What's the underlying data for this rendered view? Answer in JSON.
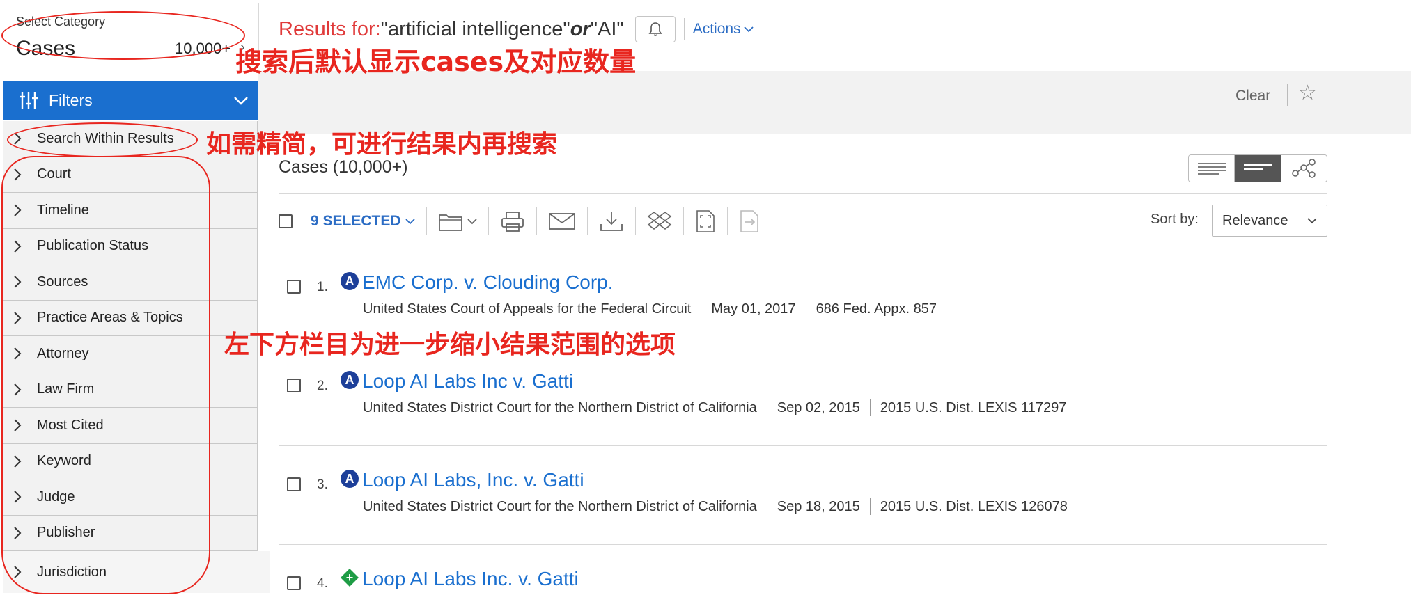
{
  "category": {
    "label": "Select Category",
    "value": "Cases",
    "count": "10,000+"
  },
  "results_header": {
    "prefix": "Results for:",
    "term1": "\"artificial intelligence\"",
    "operator": "or",
    "term2": "\"AI\"",
    "actions": "Actions"
  },
  "toolbar_band": {
    "clear": "Clear"
  },
  "filters": {
    "title": "Filters",
    "items": [
      "Search Within Results",
      "Court",
      "Timeline",
      "Publication Status",
      "Sources",
      "Practice Areas & Topics",
      "Attorney",
      "Law Firm",
      "Most Cited",
      "Keyword",
      "Judge",
      "Publisher",
      "Jurisdiction"
    ]
  },
  "annotations": {
    "a1": "搜索后默认显示cases及对应数量",
    "a2": "如需精简，可进行结果内再搜索",
    "a3": "左下方栏目为进一步缩小结果范围的选项"
  },
  "content": {
    "cases_count": "Cases (10,000+)",
    "selected": "9 SELECTED",
    "sort_label": "Sort by:",
    "sort_value": "Relevance"
  },
  "results": [
    {
      "num": "1.",
      "badge": "A",
      "title": "EMC Corp. v. Clouding Corp.",
      "court": "United States Court of Appeals for the Federal Circuit",
      "date": "May 01, 2017",
      "cite": "686 Fed. Appx. 857"
    },
    {
      "num": "2.",
      "badge": "A",
      "title": "Loop AI Labs Inc v. Gatti",
      "court": "United States District Court for the Northern District of California",
      "date": "Sep 02, 2015",
      "cite": "2015 U.S. Dist. LEXIS 117297"
    },
    {
      "num": "3.",
      "badge": "A",
      "title": "Loop AI Labs, Inc. v. Gatti",
      "court": "United States District Court for the Northern District of California",
      "date": "Sep 18, 2015",
      "cite": "2015 U.S. Dist. LEXIS 126078"
    },
    {
      "num": "4.",
      "badge": "+",
      "title": "Loop AI Labs Inc. v. Gatti"
    }
  ],
  "colors": {
    "brand_blue": "#1a6fcf",
    "link_blue": "#2b6cc4",
    "annotation_red": "#e8261f",
    "results_red": "#e03a3a"
  }
}
